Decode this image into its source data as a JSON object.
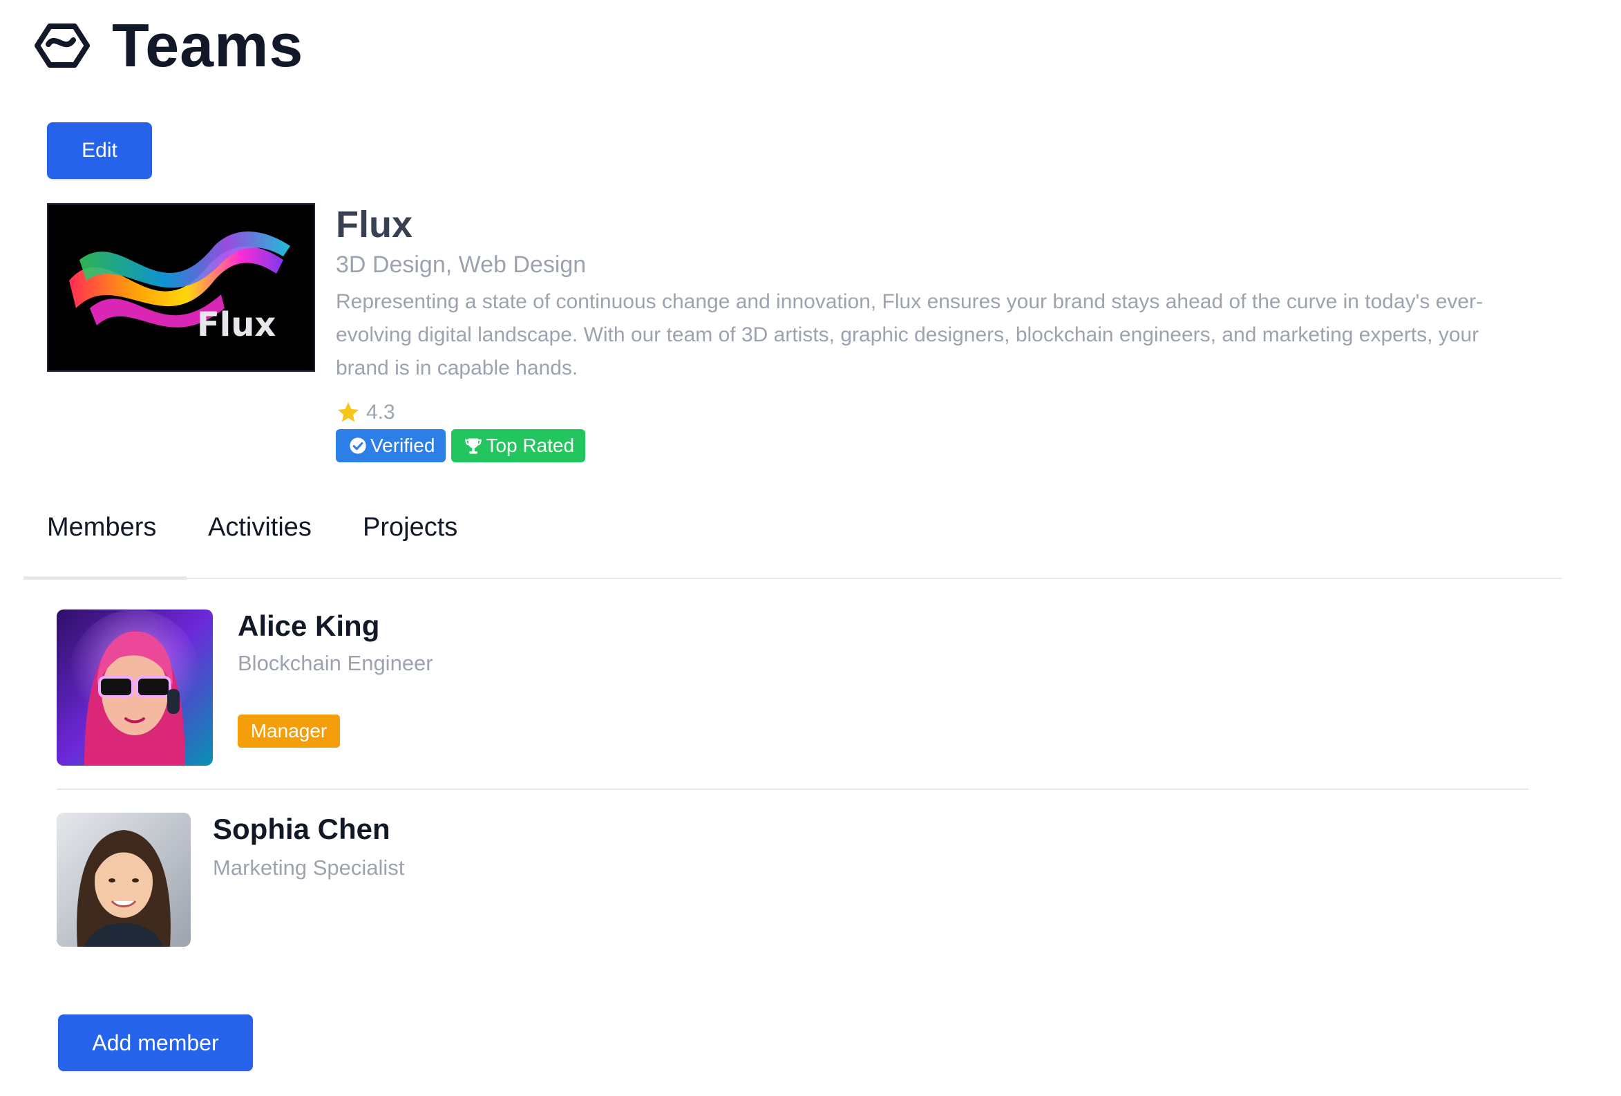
{
  "header": {
    "title": "Teams",
    "logo_icon": "hexagon-logo-icon"
  },
  "actions": {
    "edit_label": "Edit",
    "add_member_label": "Add member"
  },
  "team": {
    "name": "Flux",
    "categories": "3D Design, Web Design",
    "description": "Representing a state of continuous change and innovation, Flux ensures your brand stays ahead of the curve in today's ever-evolving digital landscape. With our team of 3D artists, graphic designers, blockchain engineers, and marketing experts, your brand is in capable hands.",
    "logo_text": "Flux",
    "rating": "4.3",
    "badges": [
      {
        "label": "Verified",
        "icon": "check-circle-icon",
        "color": "#2d7fe8"
      },
      {
        "label": "Top Rated",
        "icon": "trophy-icon",
        "color": "#22c55e"
      }
    ]
  },
  "tabs": [
    {
      "label": "Members",
      "active": true
    },
    {
      "label": "Activities",
      "active": false
    },
    {
      "label": "Projects",
      "active": false
    }
  ],
  "members": [
    {
      "name": "Alice King",
      "role": "Blockchain Engineer",
      "badge": "Manager",
      "badge_color": "#f59e0b"
    },
    {
      "name": "Sophia Chen",
      "role": "Marketing Specialist"
    }
  ],
  "colors": {
    "primary": "#2563eb",
    "text": "#111827",
    "muted": "#9ca3af"
  }
}
